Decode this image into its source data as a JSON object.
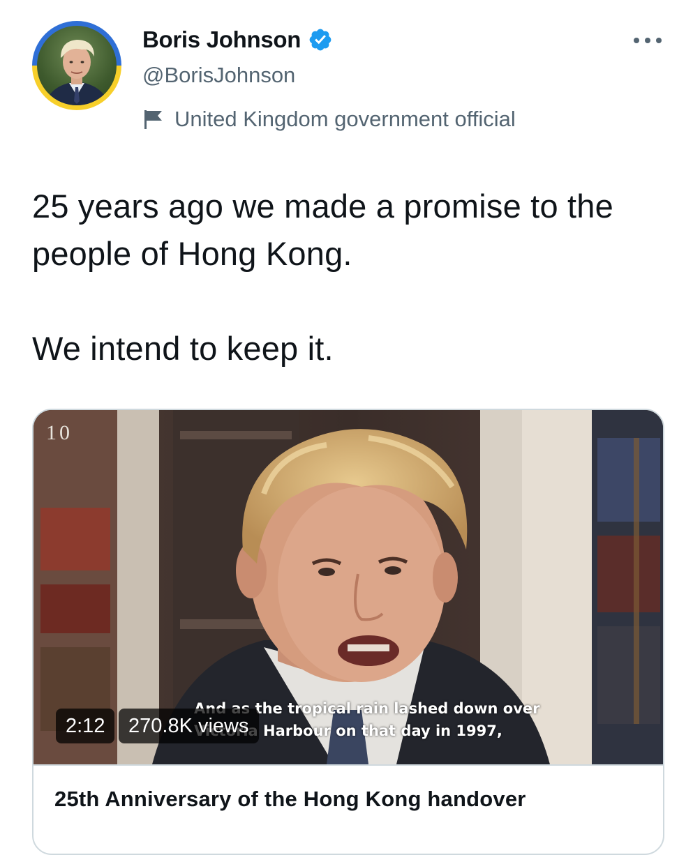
{
  "author": {
    "display_name": "Boris Johnson",
    "handle": "@BorisJohnson",
    "label": "United Kingdom government official",
    "avatar_icon": "profile-photo-avatar",
    "avatar_ring_colors": [
      "#2f6fd6",
      "#f7cf2a"
    ],
    "verified_icon": "verified-badge-icon",
    "verified_color": "#1d9bf0",
    "label_icon": "flag-icon"
  },
  "menu": {
    "more_icon": "more-options-icon"
  },
  "tweet": {
    "paragraphs": [
      "25 years ago we made a promise to the people of Hong Kong.",
      "We intend to keep it."
    ]
  },
  "media": {
    "watermark": "10",
    "subtitle_lines": [
      "And as the tropical rain lashed down over",
      "Victoria Harbour on that day in 1997,"
    ],
    "duration": "2:12",
    "views": "270.8K views",
    "card_title": "25th Anniversary of the Hong Kong handover"
  }
}
